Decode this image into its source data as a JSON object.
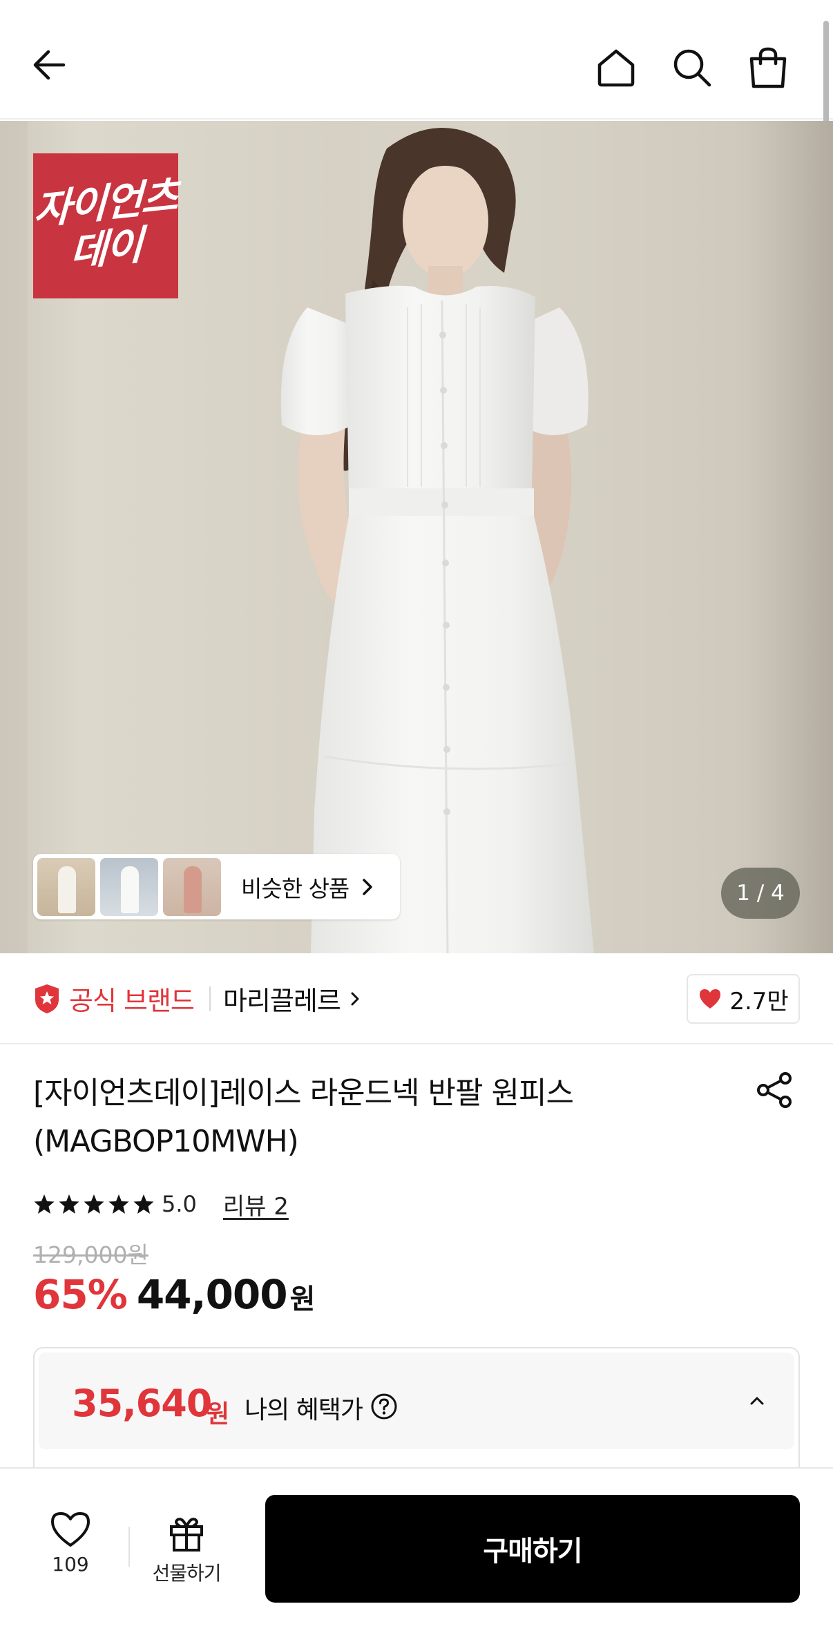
{
  "header": {
    "back_icon": "arrow-left-icon",
    "home_icon": "home-icon",
    "search_icon": "search-icon",
    "cart_icon": "shopping-bag-icon"
  },
  "hero": {
    "event_badge_line1": "자이언츠",
    "event_badge_line2": "데이",
    "event_badge_color": "#c8343f",
    "similar_products_label": "비슷한 상품",
    "image_counter": "1 / 4"
  },
  "brand": {
    "official_label": "공식 브랜드",
    "name": "마리끌레르",
    "like_count": "2.7만",
    "accent_color": "#e0353a"
  },
  "product": {
    "title_line1": "[자이언츠데이]레이스 라운드넥 반팔 원피스",
    "title_line2": "(MAGBOP10MWH)",
    "rating": "5.0",
    "stars": 5,
    "review_link": "리뷰 2",
    "original_price": "129,000원",
    "discount_rate": "65%",
    "price": "44,000",
    "price_unit": "원"
  },
  "benefit": {
    "price": "35,640",
    "unit": "원",
    "label": "나의 혜택가"
  },
  "bottom_bar": {
    "wish_count": "109",
    "gift_label": "선물하기",
    "buy_label": "구매하기"
  }
}
